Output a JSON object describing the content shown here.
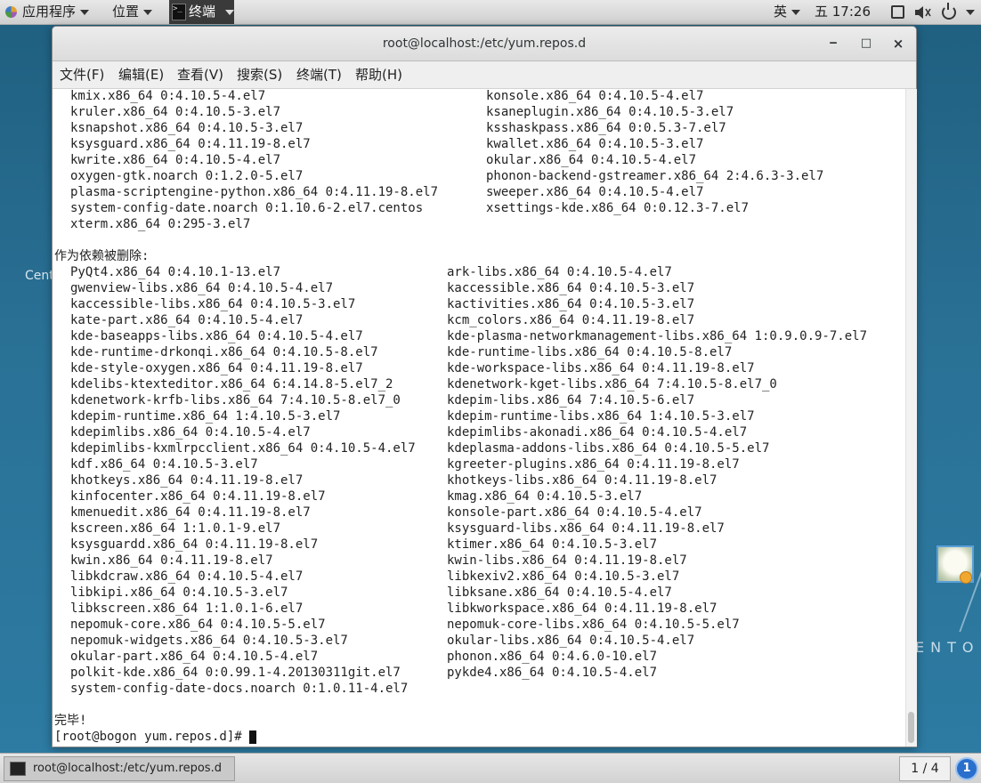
{
  "top_panel": {
    "applications": "应用程序",
    "places": "位置",
    "task_terminal": "终端",
    "input_method": "英",
    "clock": "五 17:26"
  },
  "desktop": {
    "label_cento": "Cent",
    "label_centos": "ENTO"
  },
  "window": {
    "title": "root@localhost:/etc/yum.repos.d",
    "minimize": "‒",
    "maximize": "□",
    "close": "×",
    "menu": [
      "文件(F)",
      "编辑(E)",
      "查看(V)",
      "搜索(S)",
      "终端(T)",
      "帮助(H)"
    ]
  },
  "terminal": {
    "top_rows": [
      [
        "kmix.x86_64 0:4.10.5-4.el7",
        "konsole.x86_64 0:4.10.5-4.el7"
      ],
      [
        "kruler.x86_64 0:4.10.5-3.el7",
        "ksaneplugin.x86_64 0:4.10.5-3.el7"
      ],
      [
        "ksnapshot.x86_64 0:4.10.5-3.el7",
        "ksshaskpass.x86_64 0:0.5.3-7.el7"
      ],
      [
        "ksysguard.x86_64 0:4.11.19-8.el7",
        "kwallet.x86_64 0:4.10.5-3.el7"
      ],
      [
        "kwrite.x86_64 0:4.10.5-4.el7",
        "okular.x86_64 0:4.10.5-4.el7"
      ],
      [
        "oxygen-gtk.noarch 0:1.2.0-5.el7",
        "phonon-backend-gstreamer.x86_64 2:4.6.3-3.el7"
      ],
      [
        "plasma-scriptengine-python.x86_64 0:4.11.19-8.el7",
        "sweeper.x86_64 0:4.10.5-4.el7"
      ],
      [
        "system-config-date.noarch 0:1.10.6-2.el7.centos",
        "xsettings-kde.x86_64 0:0.12.3-7.el7"
      ],
      [
        "xterm.x86_64 0:295-3.el7",
        ""
      ]
    ],
    "section_header": "作为依赖被删除:",
    "dep_rows": [
      [
        "PyQt4.x86_64 0:4.10.1-13.el7",
        "ark-libs.x86_64 0:4.10.5-4.el7"
      ],
      [
        "gwenview-libs.x86_64 0:4.10.5-4.el7",
        "kaccessible.x86_64 0:4.10.5-3.el7"
      ],
      [
        "kaccessible-libs.x86_64 0:4.10.5-3.el7",
        "kactivities.x86_64 0:4.10.5-3.el7"
      ],
      [
        "kate-part.x86_64 0:4.10.5-4.el7",
        "kcm_colors.x86_64 0:4.11.19-8.el7"
      ],
      [
        "kde-baseapps-libs.x86_64 0:4.10.5-4.el7",
        "kde-plasma-networkmanagement-libs.x86_64 1:0.9.0.9-7.el7"
      ],
      [
        "kde-runtime-drkonqi.x86_64 0:4.10.5-8.el7",
        "kde-runtime-libs.x86_64 0:4.10.5-8.el7"
      ],
      [
        "kde-style-oxygen.x86_64 0:4.11.19-8.el7",
        "kde-workspace-libs.x86_64 0:4.11.19-8.el7"
      ],
      [
        "kdelibs-ktexteditor.x86_64 6:4.14.8-5.el7_2",
        "kdenetwork-kget-libs.x86_64 7:4.10.5-8.el7_0"
      ],
      [
        "kdenetwork-krfb-libs.x86_64 7:4.10.5-8.el7_0",
        "kdepim-libs.x86_64 7:4.10.5-6.el7"
      ],
      [
        "kdepim-runtime.x86_64 1:4.10.5-3.el7",
        "kdepim-runtime-libs.x86_64 1:4.10.5-3.el7"
      ],
      [
        "kdepimlibs.x86_64 0:4.10.5-4.el7",
        "kdepimlibs-akonadi.x86_64 0:4.10.5-4.el7"
      ],
      [
        "kdepimlibs-kxmlrpcclient.x86_64 0:4.10.5-4.el7",
        "kdeplasma-addons-libs.x86_64 0:4.10.5-5.el7"
      ],
      [
        "kdf.x86_64 0:4.10.5-3.el7",
        "kgreeter-plugins.x86_64 0:4.11.19-8.el7"
      ],
      [
        "khotkeys.x86_64 0:4.11.19-8.el7",
        "khotkeys-libs.x86_64 0:4.11.19-8.el7"
      ],
      [
        "kinfocenter.x86_64 0:4.11.19-8.el7",
        "kmag.x86_64 0:4.10.5-3.el7"
      ],
      [
        "kmenuedit.x86_64 0:4.11.19-8.el7",
        "konsole-part.x86_64 0:4.10.5-4.el7"
      ],
      [
        "kscreen.x86_64 1:1.0.1-9.el7",
        "ksysguard-libs.x86_64 0:4.11.19-8.el7"
      ],
      [
        "ksysguardd.x86_64 0:4.11.19-8.el7",
        "ktimer.x86_64 0:4.10.5-3.el7"
      ],
      [
        "kwin.x86_64 0:4.11.19-8.el7",
        "kwin-libs.x86_64 0:4.11.19-8.el7"
      ],
      [
        "libkdcraw.x86_64 0:4.10.5-4.el7",
        "libkexiv2.x86_64 0:4.10.5-3.el7"
      ],
      [
        "libkipi.x86_64 0:4.10.5-3.el7",
        "libksane.x86_64 0:4.10.5-4.el7"
      ],
      [
        "libkscreen.x86_64 1:1.0.1-6.el7",
        "libkworkspace.x86_64 0:4.11.19-8.el7"
      ],
      [
        "nepomuk-core.x86_64 0:4.10.5-5.el7",
        "nepomuk-core-libs.x86_64 0:4.10.5-5.el7"
      ],
      [
        "nepomuk-widgets.x86_64 0:4.10.5-3.el7",
        "okular-libs.x86_64 0:4.10.5-4.el7"
      ],
      [
        "okular-part.x86_64 0:4.10.5-4.el7",
        "phonon.x86_64 0:4.6.0-10.el7"
      ],
      [
        "polkit-kde.x86_64 0:0.99.1-4.20130311git.el7",
        "pykde4.x86_64 0:4.10.5-4.el7"
      ],
      [
        "system-config-date-docs.noarch 0:1.0.11-4.el7",
        ""
      ]
    ],
    "done": "完毕!",
    "prompt": "[root@bogon yum.repos.d]# "
  },
  "bottom_panel": {
    "task_label": "root@localhost:/etc/yum.repos.d",
    "workspace": "1 / 4",
    "notifications": "1"
  }
}
